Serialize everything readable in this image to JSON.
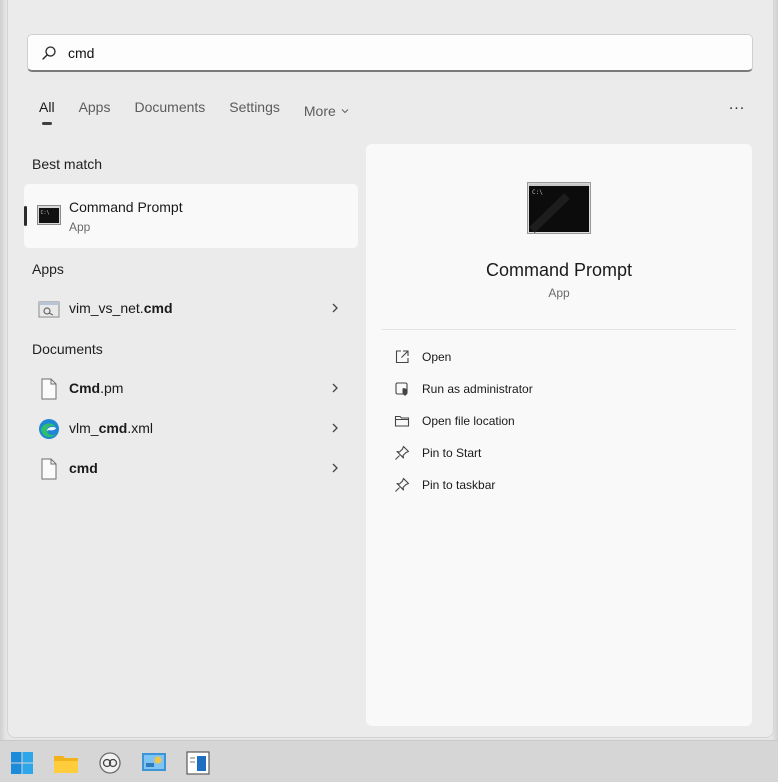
{
  "search": {
    "value": "cmd",
    "placeholder": ""
  },
  "tabs": [
    {
      "label": "All",
      "active": true
    },
    {
      "label": "Apps"
    },
    {
      "label": "Documents"
    },
    {
      "label": "Settings"
    },
    {
      "label": "More"
    }
  ],
  "overflow_label": "...",
  "best_match": {
    "heading": "Best match",
    "title": "Command Prompt",
    "subtitle": "App",
    "icon": "command-prompt-icon"
  },
  "apps": {
    "heading": "Apps",
    "items": [
      {
        "prefix": "vim_vs_net.",
        "match": "cmd",
        "icon": "script-icon"
      }
    ]
  },
  "documents": {
    "heading": "Documents",
    "items": [
      {
        "match": "Cmd",
        "suffix": ".pm",
        "icon": "file-icon"
      },
      {
        "prefix": "vlm_",
        "match": "cmd",
        "suffix": ".xml",
        "icon": "edge-icon"
      },
      {
        "match": "cmd",
        "icon": "file-icon"
      }
    ]
  },
  "detail": {
    "title": "Command Prompt",
    "subtitle": "App",
    "actions": [
      {
        "label": "Open",
        "icon": "open-icon"
      },
      {
        "label": "Run as administrator",
        "icon": "shield-icon"
      },
      {
        "label": "Open file location",
        "icon": "folder-icon"
      },
      {
        "label": "Pin to Start",
        "icon": "pin-icon"
      },
      {
        "label": "Pin to taskbar",
        "icon": "pin-icon"
      }
    ]
  },
  "taskbar": {
    "items": [
      "start-icon",
      "file-explorer-icon",
      "copilot-icon",
      "control-panel-icon",
      "app-window-icon"
    ]
  },
  "colors": {
    "panel": "#ebebeb",
    "card": "#f9f9f9",
    "accent": "#2b2b2b",
    "edge_blue": "#1f86d6"
  }
}
